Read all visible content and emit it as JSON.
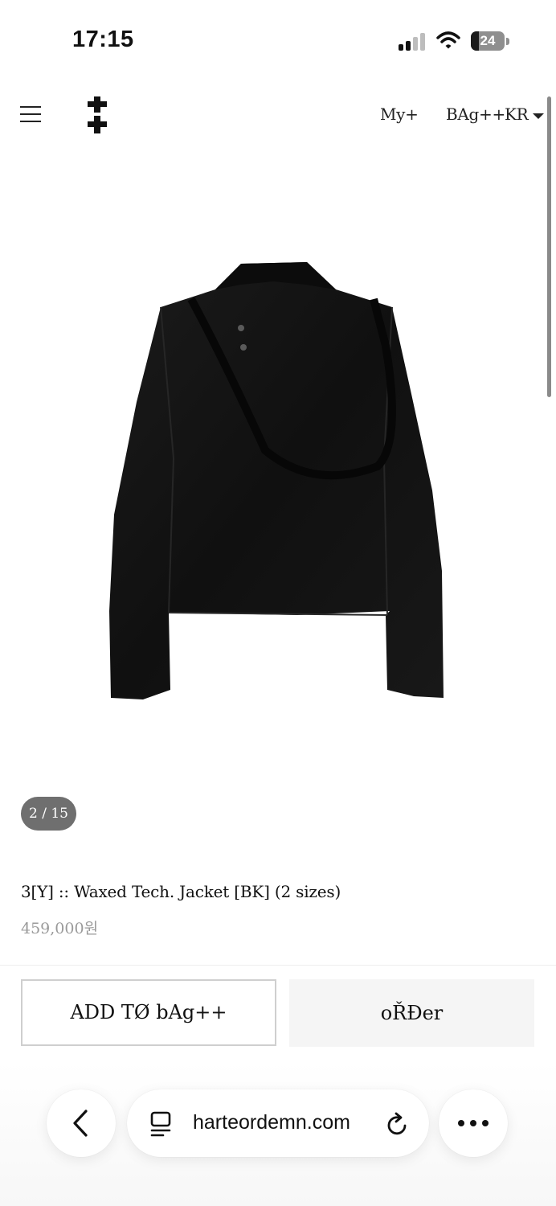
{
  "status_bar": {
    "time": "17:15",
    "battery_percent": "24"
  },
  "header": {
    "menu_icon": "hamburger-menu-icon",
    "logo_icon": "double-cross-logo",
    "my_label": "My+",
    "bag_label": "BAg++",
    "lang_label": "KR"
  },
  "gallery": {
    "counter": "2 / 15",
    "image_icon": "black-waxed-jacket-back-view"
  },
  "product": {
    "name": "3[Y] :: Waxed Tech. Jacket [BK] (2 sizes)",
    "price": "459,000원"
  },
  "actions": {
    "add_to_bag": "ADD TØ bAg++",
    "order": "oŘĐer"
  },
  "browser": {
    "url": "harteordemn.com",
    "back_icon": "chevron-left-icon",
    "tabs_icon": "page-tabs-icon",
    "reload_icon": "reload-icon",
    "more_icon": "more-dots-icon"
  }
}
